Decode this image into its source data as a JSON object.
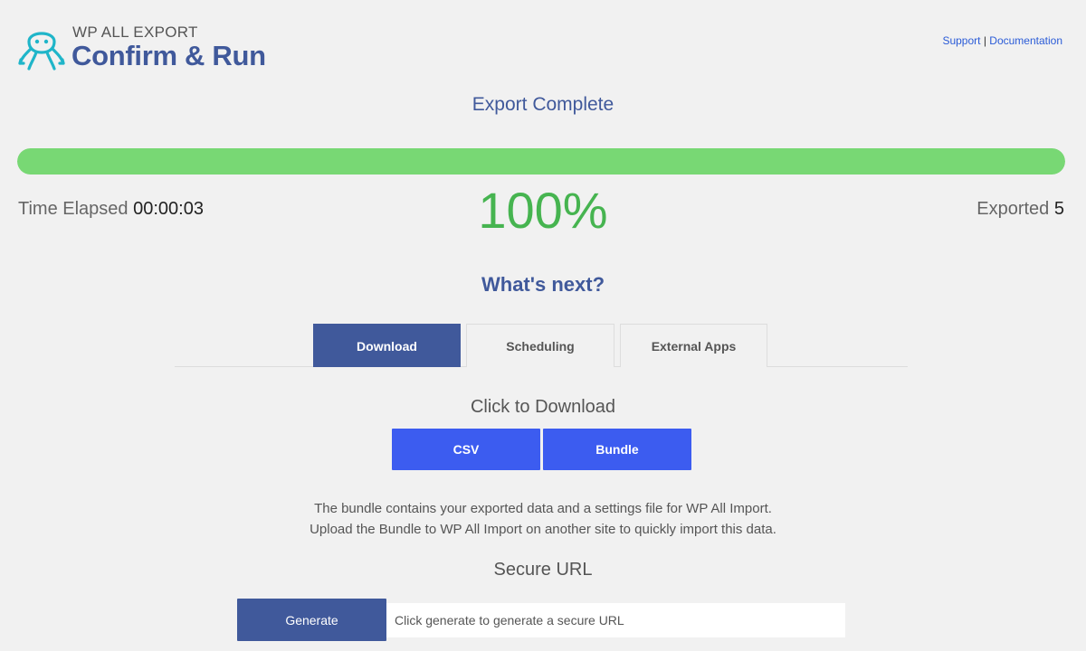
{
  "brand": {
    "small": "WP ALL EXPORT",
    "title": "Confirm & Run",
    "logo_icon": "octopus-icon",
    "accent_color": "#40599b",
    "logo_color": "#1fb5c9"
  },
  "top_links": {
    "support": "Support",
    "separator": "|",
    "documentation": "Documentation"
  },
  "status": {
    "title": "Export Complete",
    "progress_percent": 100,
    "percent_label": "100%",
    "progress_color": "#78d874",
    "time_label": "Time Elapsed",
    "time_value": "00:00:03",
    "exported_label": "Exported",
    "exported_value": "5"
  },
  "next": {
    "title": "What's next?",
    "tabs": [
      {
        "label": "Download",
        "active": true
      },
      {
        "label": "Scheduling",
        "active": false
      },
      {
        "label": "External Apps",
        "active": false
      }
    ]
  },
  "download": {
    "title": "Click to Download",
    "csv_label": "CSV",
    "bundle_label": "Bundle",
    "desc_line1": "The bundle contains your exported data and a settings file for WP All Import.",
    "desc_line2": "Upload the Bundle to WP All Import on another site to quickly import this data."
  },
  "secure_url": {
    "title": "Secure URL",
    "generate_label": "Generate",
    "placeholder": "Click generate to generate a secure URL",
    "value": ""
  }
}
